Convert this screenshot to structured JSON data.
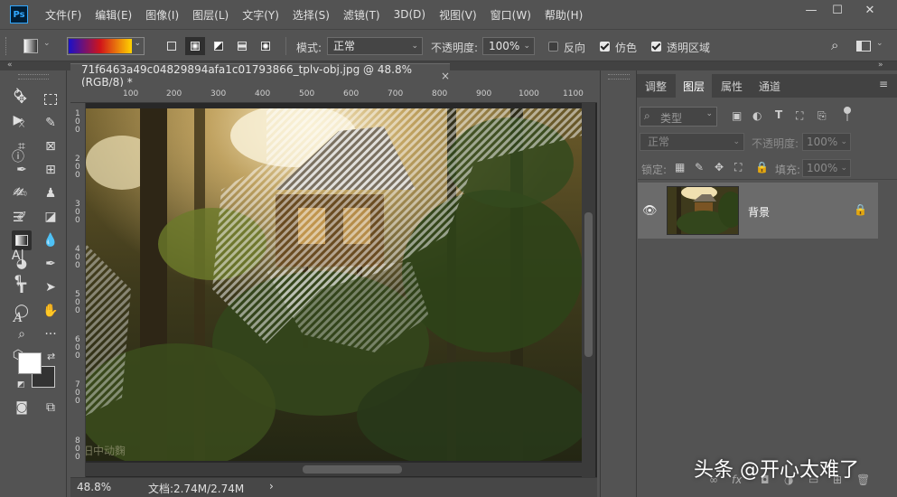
{
  "app": {
    "logo_text": "Ps"
  },
  "menu": [
    "文件(F)",
    "编辑(E)",
    "图像(I)",
    "图层(L)",
    "文字(Y)",
    "选择(S)",
    "滤镜(T)",
    "3D(D)",
    "视图(V)",
    "窗口(W)",
    "帮助(H)"
  ],
  "window_controls": {
    "minimize": "—",
    "maximize": "☐",
    "close": "✕"
  },
  "options": {
    "mode_label": "模式:",
    "mode_value": "正常",
    "opacity_label": "不透明度:",
    "opacity_value": "100%",
    "reverse_label": "反向",
    "dither_label": "仿色",
    "transparency_label": "透明区域",
    "reverse_checked": false,
    "dither_checked": true,
    "transparency_checked": true,
    "gradient_colors": [
      "#1a10c8",
      "#d0141a",
      "#ffd300"
    ]
  },
  "document": {
    "tab_title": "71f6463a49c04829894afa1c01793866_tplv-obj.jpg @ 48.8%(RGB/8) *",
    "tab_close": "×",
    "ruler_top": [
      "100",
      "200",
      "300",
      "400",
      "500",
      "600",
      "700",
      "800",
      "900",
      "1000",
      "1100"
    ],
    "ruler_left": [
      "1\n0\n0",
      "2\n0\n0",
      "3\n0\n0",
      "4\n0\n0",
      "5\n0\n0",
      "6\n0\n0",
      "7\n0\n0",
      "8\n0\n0"
    ],
    "photo_watermark": "旧中动麴"
  },
  "status": {
    "zoom": "48.8%",
    "doc_info": "文档:2.74M/2.74M",
    "arrow": "›"
  },
  "panel": {
    "tabs": [
      "调整",
      "图层",
      "属性",
      "通道"
    ],
    "active_tab": "图层",
    "filter_placeholder": "类型",
    "blend_mode": "正常",
    "opacity_label": "不透明度:",
    "opacity_value": "100%",
    "lock_label": "锁定:",
    "fill_label": "填充:",
    "fill_value": "100%",
    "layer_name": "背景"
  },
  "overlay_watermark": "头条 @开心太难了"
}
